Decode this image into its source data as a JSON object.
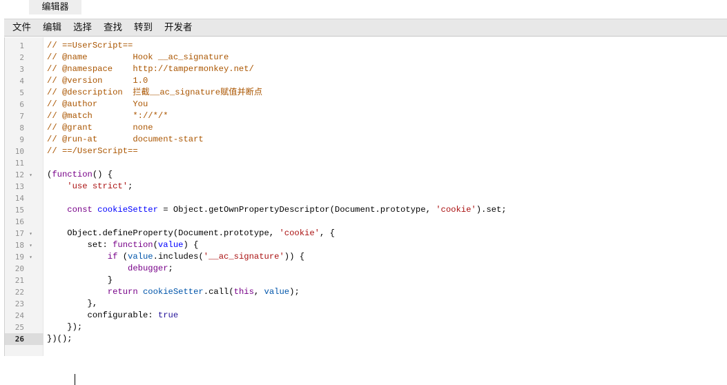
{
  "tab": {
    "label": "编辑器"
  },
  "menu": [
    {
      "label": "文件"
    },
    {
      "label": "编辑"
    },
    {
      "label": "选择"
    },
    {
      "label": "查找"
    },
    {
      "label": "转到"
    },
    {
      "label": "开发者"
    }
  ],
  "gutter": {
    "active_line": 26,
    "fold_lines": [
      12,
      17,
      18,
      19
    ]
  },
  "code_lines": [
    [
      [
        "c-comment",
        "// ==UserScript=="
      ]
    ],
    [
      [
        "c-comment",
        "// @name         Hook __ac_signature"
      ]
    ],
    [
      [
        "c-comment",
        "// @namespace    http://tampermonkey.net/"
      ]
    ],
    [
      [
        "c-comment",
        "// @version      1.0"
      ]
    ],
    [
      [
        "c-comment",
        "// @description  拦截__ac_signature赋值并断点"
      ]
    ],
    [
      [
        "c-comment",
        "// @author       You"
      ]
    ],
    [
      [
        "c-comment",
        "// @match        *://*/*"
      ]
    ],
    [
      [
        "c-comment",
        "// @grant        none"
      ]
    ],
    [
      [
        "c-comment",
        "// @run-at       document-start"
      ]
    ],
    [
      [
        "c-comment",
        "// ==/UserScript=="
      ]
    ],
    [],
    [
      [
        "c-plain",
        "("
      ],
      [
        "c-keyword",
        "function"
      ],
      [
        "c-plain",
        "() {"
      ]
    ],
    [
      [
        "c-plain",
        "    "
      ],
      [
        "c-string",
        "'use strict'"
      ],
      [
        "c-plain",
        ";"
      ]
    ],
    [],
    [
      [
        "c-plain",
        "    "
      ],
      [
        "c-keyword",
        "const"
      ],
      [
        "c-plain",
        " "
      ],
      [
        "c-def",
        "cookieSetter"
      ],
      [
        "c-plain",
        " = Object.getOwnPropertyDescriptor(Document.prototype, "
      ],
      [
        "c-string",
        "'cookie'"
      ],
      [
        "c-plain",
        ").set;"
      ]
    ],
    [],
    [
      [
        "c-plain",
        "    Object.defineProperty(Document.prototype, "
      ],
      [
        "c-string",
        "'cookie'"
      ],
      [
        "c-plain",
        ", {"
      ]
    ],
    [
      [
        "c-plain",
        "        set: "
      ],
      [
        "c-keyword",
        "function"
      ],
      [
        "c-plain",
        "("
      ],
      [
        "c-def",
        "value"
      ],
      [
        "c-plain",
        ") {"
      ]
    ],
    [
      [
        "c-plain",
        "            "
      ],
      [
        "c-keyword",
        "if"
      ],
      [
        "c-plain",
        " ("
      ],
      [
        "c-var2",
        "value"
      ],
      [
        "c-plain",
        ".includes("
      ],
      [
        "c-string",
        "'__ac_signature'"
      ],
      [
        "c-plain",
        ")) {"
      ]
    ],
    [
      [
        "c-plain",
        "                "
      ],
      [
        "c-keyword",
        "debugger"
      ],
      [
        "c-plain",
        ";"
      ]
    ],
    [
      [
        "c-plain",
        "            }"
      ]
    ],
    [
      [
        "c-plain",
        "            "
      ],
      [
        "c-keyword",
        "return"
      ],
      [
        "c-plain",
        " "
      ],
      [
        "c-var2",
        "cookieSetter"
      ],
      [
        "c-plain",
        ".call("
      ],
      [
        "c-keyword",
        "this"
      ],
      [
        "c-plain",
        ", "
      ],
      [
        "c-var2",
        "value"
      ],
      [
        "c-plain",
        ");"
      ]
    ],
    [
      [
        "c-plain",
        "        },"
      ]
    ],
    [
      [
        "c-plain",
        "        configurable: "
      ],
      [
        "c-atom",
        "true"
      ]
    ],
    [
      [
        "c-plain",
        "    });"
      ]
    ],
    [
      [
        "c-plain",
        "})();"
      ]
    ]
  ]
}
